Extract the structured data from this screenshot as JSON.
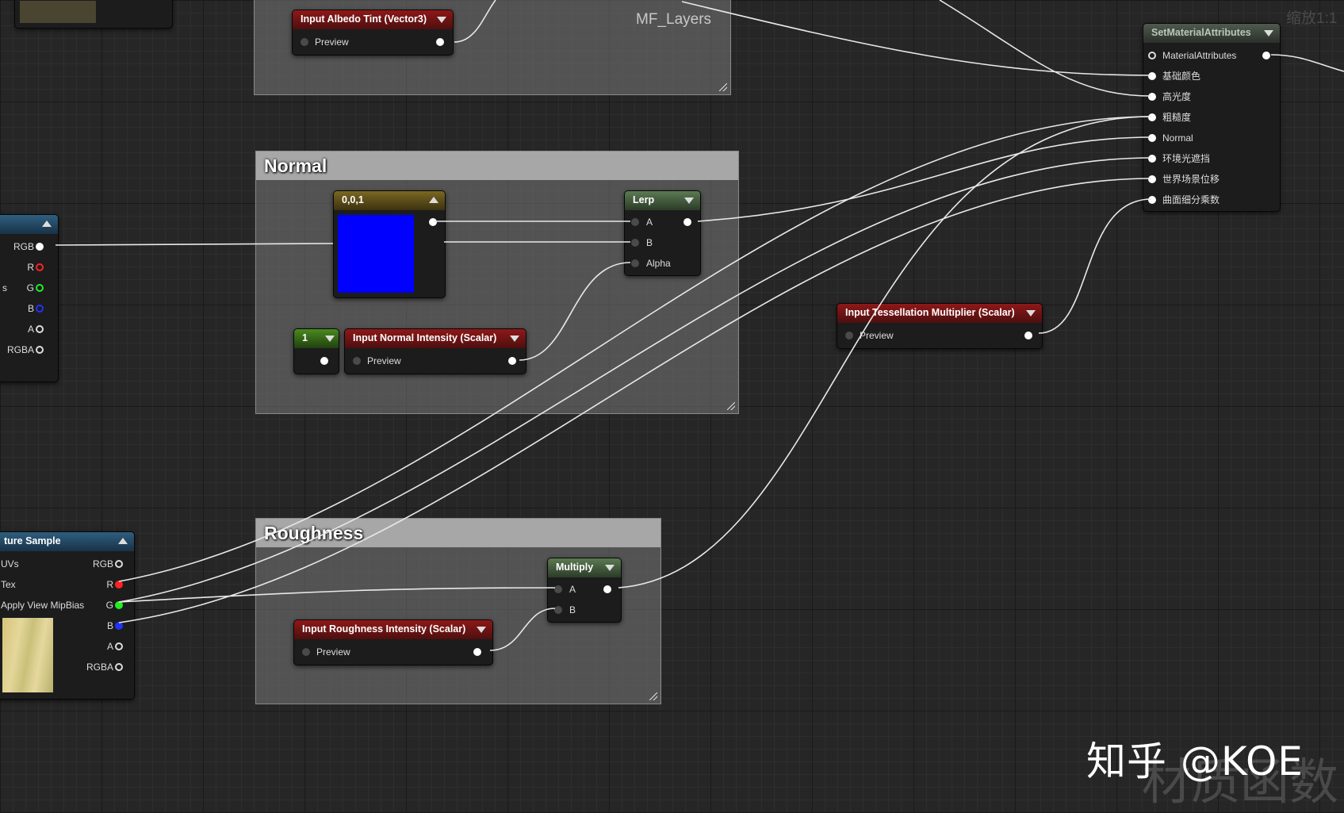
{
  "zoom_label": "缩放1:1",
  "graph_label": "MF_Layers",
  "comments": {
    "normal": "Normal",
    "roughness": "Roughness"
  },
  "nodes": {
    "albedo_tint": {
      "title": "Input Albedo Tint (Vector3)",
      "output": "Preview"
    },
    "set_material_attributes": {
      "title": "SetMaterialAttributes",
      "pins": [
        "MaterialAttributes",
        "基础颜色",
        "高光度",
        "粗糙度",
        "Normal",
        "环境光遮挡",
        "世界场景位移",
        "曲面细分乘数"
      ]
    },
    "texture_left": {
      "pins": [
        "RGB",
        "R",
        "G",
        "B",
        "A",
        "RGBA"
      ],
      "side_label": "s"
    },
    "constant_vector": {
      "title": "0,0,1",
      "color": "#0000ff"
    },
    "lerp": {
      "title": "Lerp",
      "inputs": [
        "A",
        "B",
        "Alpha"
      ]
    },
    "constant_one": {
      "title": "1"
    },
    "normal_intensity": {
      "title": "Input Normal Intensity (Scalar)",
      "output": "Preview"
    },
    "tessellation": {
      "title": "Input Tessellation Multiplier (Scalar)",
      "output": "Preview"
    },
    "texture_sample": {
      "title": "ture Sample",
      "inputs": [
        "UVs",
        "Tex",
        "Apply View MipBias"
      ],
      "outputs": [
        "RGB",
        "R",
        "G",
        "B",
        "A",
        "RGBA"
      ]
    },
    "multiply": {
      "title": "Multiply",
      "inputs": [
        "A",
        "B"
      ]
    },
    "roughness_intensity": {
      "title": "Input Roughness Intensity (Scalar)",
      "output": "Preview"
    }
  },
  "watermark": {
    "text": "知乎 @KOE",
    "background_text": "材质函数"
  }
}
